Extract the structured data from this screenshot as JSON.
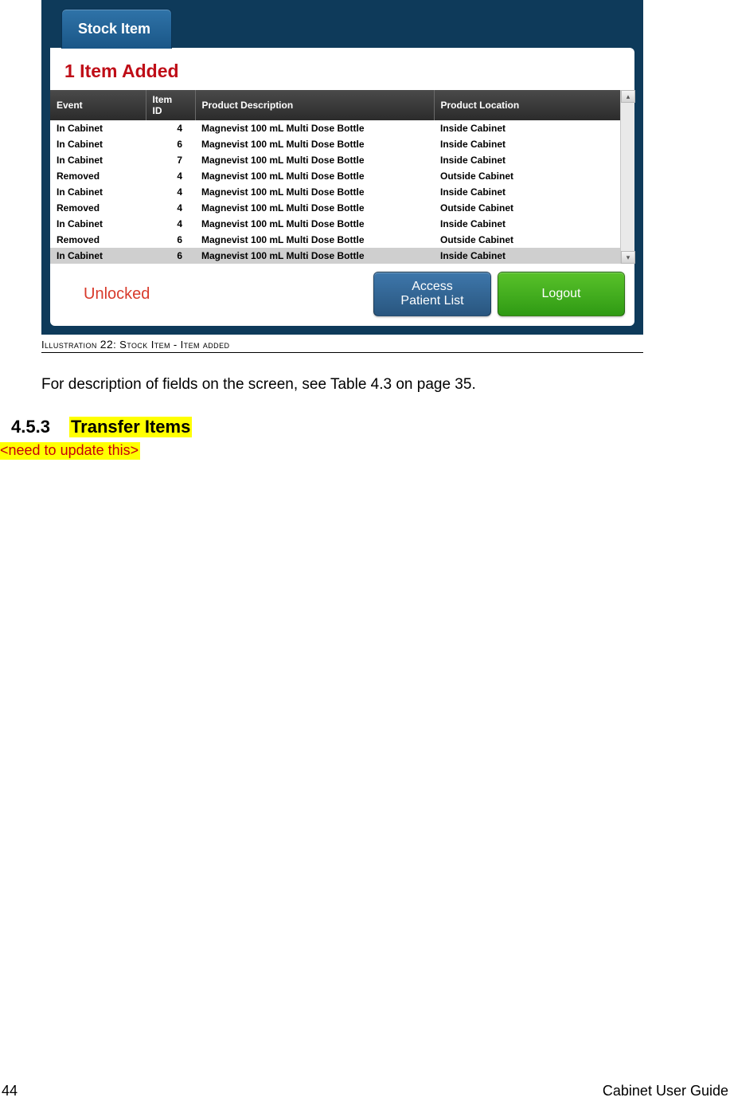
{
  "screenshot": {
    "tab_label": "Stock Item",
    "banner_text": "1 Item Added",
    "columns": {
      "event": "Event",
      "item_id": "Item ID",
      "desc": "Product Description",
      "loc": "Product Location"
    },
    "rows": [
      {
        "event": "In Cabinet",
        "id": "4",
        "desc": "Magnevist 100 mL Multi Dose Bottle",
        "loc": "Inside Cabinet"
      },
      {
        "event": "In Cabinet",
        "id": "6",
        "desc": "Magnevist 100 mL Multi Dose Bottle",
        "loc": "Inside Cabinet"
      },
      {
        "event": "In Cabinet",
        "id": "7",
        "desc": "Magnevist 100 mL Multi Dose Bottle",
        "loc": "Inside Cabinet"
      },
      {
        "event": "Removed",
        "id": "4",
        "desc": "Magnevist 100 mL Multi Dose Bottle",
        "loc": "Outside Cabinet"
      },
      {
        "event": "In Cabinet",
        "id": "4",
        "desc": "Magnevist 100 mL Multi Dose Bottle",
        "loc": "Inside Cabinet"
      },
      {
        "event": "Removed",
        "id": "4",
        "desc": "Magnevist 100 mL Multi Dose Bottle",
        "loc": "Outside Cabinet"
      },
      {
        "event": "In Cabinet",
        "id": "4",
        "desc": "Magnevist 100 mL Multi Dose Bottle",
        "loc": "Inside Cabinet"
      },
      {
        "event": "Removed",
        "id": "6",
        "desc": "Magnevist 100 mL Multi Dose Bottle",
        "loc": "Outside Cabinet"
      },
      {
        "event": "In Cabinet",
        "id": "6",
        "desc": "Magnevist 100 mL Multi Dose Bottle",
        "loc": "Inside Cabinet"
      }
    ],
    "status": "Unlocked",
    "btn_access": "Access\nPatient List",
    "btn_logout": "Logout",
    "scroll_up": "▴",
    "scroll_down": "▾"
  },
  "caption_prefix": "Illustration ",
  "caption_num": "22",
  "caption_rest": ": Stock Item - Item added",
  "body_para": "For description of fields on the screen, see  Table 4.3 on page  35.",
  "heading_num": "4.5.3",
  "heading_text": "Transfer Items",
  "editor_note": "<need to update this>",
  "footer_page": "44",
  "footer_title": "Cabinet User Guide"
}
